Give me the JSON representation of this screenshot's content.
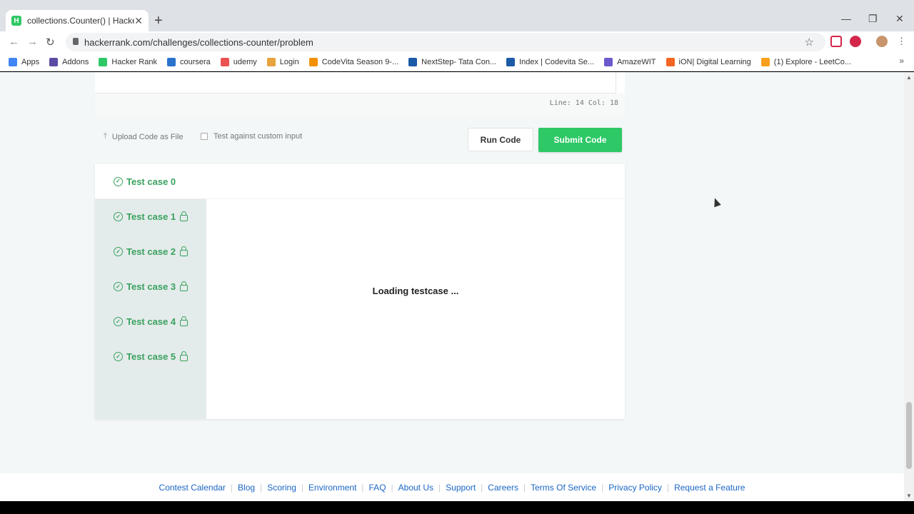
{
  "browser": {
    "tab_title": "collections.Counter() | HackerRank",
    "favicon_letter": "H",
    "url": "hackerrank.com/challenges/collections-counter/problem",
    "bookmarks": [
      {
        "label": "Apps",
        "color": "#4285f4"
      },
      {
        "label": "Addons",
        "color": "#5b4ba5"
      },
      {
        "label": "Hacker Rank",
        "color": "#2ec866"
      },
      {
        "label": "coursera",
        "color": "#2a73cc"
      },
      {
        "label": "udemy",
        "color": "#ec5252"
      },
      {
        "label": "Login",
        "color": "#e8a33d"
      },
      {
        "label": "CodeVita Season 9-...",
        "color": "#f29100"
      },
      {
        "label": "NextStep- Tata Con...",
        "color": "#1b5aa6"
      },
      {
        "label": "Index | Codevita Se...",
        "color": "#1b5aa6"
      },
      {
        "label": "AmazeWIT",
        "color": "#6a5acd"
      },
      {
        "label": "iON| Digital Learning",
        "color": "#f26522"
      },
      {
        "label": "(1) Explore - LeetCo...",
        "color": "#f89f1b"
      }
    ]
  },
  "editor": {
    "line_col": "Line: 14 Col: 18"
  },
  "actions": {
    "upload_label": "Upload Code as File",
    "custom_input_label": "Test against custom input",
    "run_label": "Run Code",
    "submit_label": "Submit Code"
  },
  "testcases": [
    {
      "label": "Test case 0",
      "locked": false
    },
    {
      "label": "Test case 1",
      "locked": true
    },
    {
      "label": "Test case 2",
      "locked": true
    },
    {
      "label": "Test case 3",
      "locked": true
    },
    {
      "label": "Test case 4",
      "locked": true
    },
    {
      "label": "Test case 5",
      "locked": true
    }
  ],
  "loading_text": "Loading testcase ...",
  "footer_links": [
    "Contest Calendar",
    "Blog",
    "Scoring",
    "Environment",
    "FAQ",
    "About Us",
    "Support",
    "Careers",
    "Terms Of Service",
    "Privacy Policy",
    "Request a Feature"
  ],
  "colors": {
    "accent_green": "#2ec866",
    "testcase_green": "#39a25e",
    "link_blue": "#1a66c5"
  }
}
